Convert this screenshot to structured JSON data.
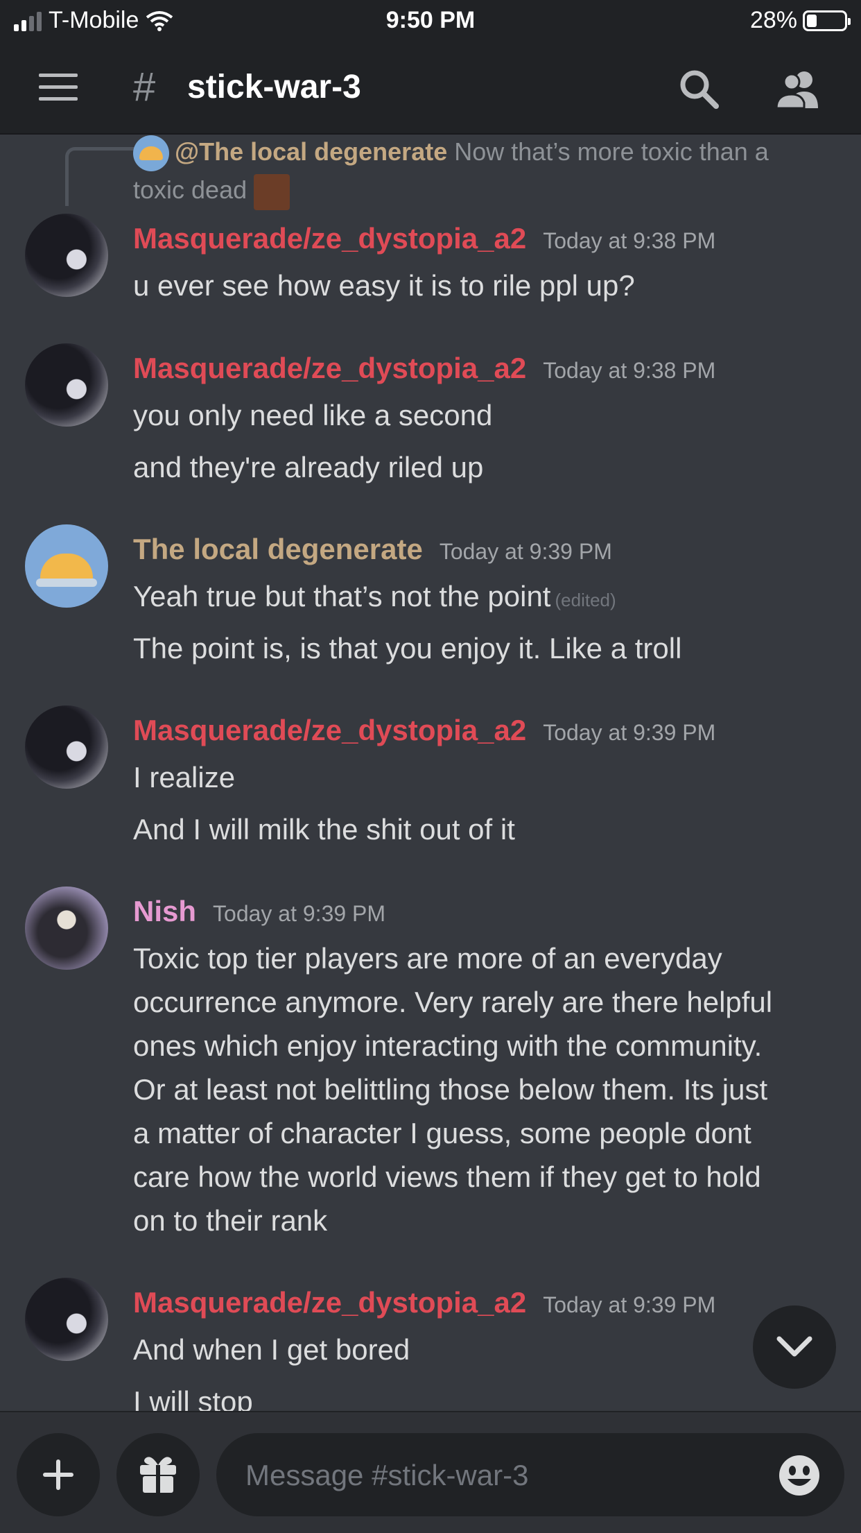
{
  "status_bar": {
    "carrier": "T-Mobile",
    "time": "9:50 PM",
    "battery": "28%"
  },
  "header": {
    "channel_hash": "#",
    "channel_name": "stick-war-3"
  },
  "reply_preview": {
    "author": "@The local degenerate",
    "text_line1": "Now that’s more toxic than a",
    "text_line2": "toxic dead"
  },
  "messages": [
    {
      "author": "Masquerade/ze_dystopia_a2",
      "timestamp": "Today at 9:38 PM",
      "lines": [
        "u ever see how easy it is to rile ppl up?"
      ]
    },
    {
      "author": "Masquerade/ze_dystopia_a2",
      "timestamp": "Today at 9:38 PM",
      "lines": [
        "you only need like a second",
        "and they're already riled up"
      ]
    },
    {
      "author": "The local degenerate",
      "timestamp": "Today at 9:39 PM",
      "lines": [
        "Yeah true but that’s not the point",
        "The point is, is that you enjoy it. Like a troll"
      ],
      "edited": "(edited)"
    },
    {
      "author": "Masquerade/ze_dystopia_a2",
      "timestamp": "Today at 9:39 PM",
      "lines": [
        "I realize",
        "And I will milk the shit out of it"
      ]
    },
    {
      "author": "Nish",
      "timestamp": "Today at 9:39 PM",
      "lines": [
        "Toxic top tier players are more of an everyday",
        "occurrence anymore. Very rarely are there helpful",
        "ones which enjoy interacting with the community.",
        "Or at least not belittling those below them. Its just",
        "a matter of character I guess, some people dont",
        "care how the world views them if they get to hold",
        "on to their rank"
      ]
    },
    {
      "author": "Masquerade/ze_dystopia_a2",
      "timestamp": "Today at 9:39 PM",
      "lines": [
        "And when I get bored",
        "I will stop"
      ]
    }
  ],
  "composer": {
    "placeholder": "Message #stick-war-3"
  },
  "icons": [
    "hamburger-icon",
    "search-icon",
    "members-icon",
    "chevron-down-icon",
    "plus-icon",
    "gift-icon",
    "emoji-icon"
  ],
  "colors": {
    "background": "#36393f",
    "header": "#202225",
    "masquerade": "#e04b56",
    "degenerate": "#c4a882",
    "nish": "#e69ad1"
  }
}
